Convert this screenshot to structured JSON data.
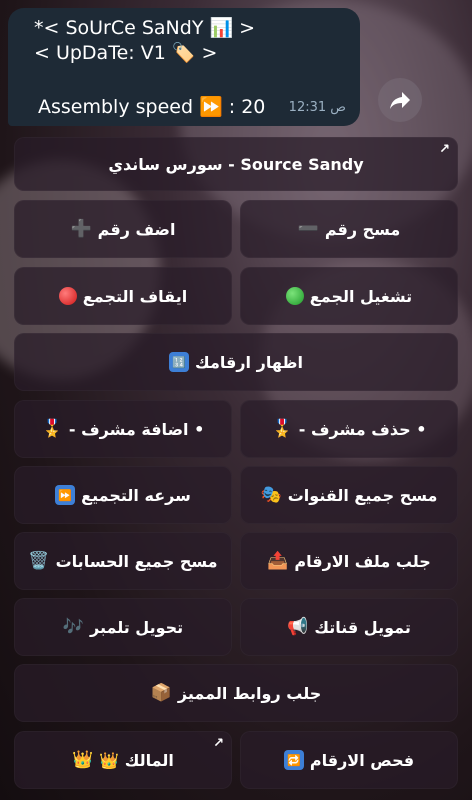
{
  "message": {
    "line1": "*< SoUrCe SaNdY 📊 >",
    "line2": "< UpDaTe: V1 🏷️ >",
    "speed": "Assembly speed ⏩ : 20",
    "time": "12:31 ص"
  },
  "keyboard": {
    "row1": {
      "label": "سورس ساندي - Source Sandy"
    },
    "row2": [
      {
        "label": "مسح رقم",
        "icon": "➖"
      },
      {
        "label": "اضف رقم",
        "icon": "➕"
      }
    ],
    "row3": [
      {
        "label": "تشغيل الجمع",
        "icon": "green-circle"
      },
      {
        "label": "ايقاف التجمع",
        "icon": "red-circle"
      }
    ],
    "row4": {
      "label": "اظهار ارقامك",
      "icon": "🔢"
    },
    "row5": [
      {
        "label": "- حذف مشرف •",
        "icon": "🎖️"
      },
      {
        "label": "- اضافة مشرف •",
        "icon": "🎖️"
      }
    ],
    "row6": [
      {
        "label": "مسح جميع القنوات",
        "icon": "🎭"
      },
      {
        "label": "سرعه التجميع",
        "icon": "⏩"
      }
    ],
    "row7": [
      {
        "label": "جلب ملف الارقام",
        "icon": "📤"
      },
      {
        "label": "مسح جميع الحسابات",
        "icon": "🗑️"
      }
    ],
    "row8": [
      {
        "label": "تمويل قناتك",
        "icon": "📢"
      },
      {
        "label": "تحويل تلمبر",
        "icon": "🎶"
      }
    ],
    "row9": {
      "label": "جلب روابط المميز",
      "icon": "📦"
    },
    "row10": [
      {
        "label": "فحص الارقام",
        "icon": "🔁"
      },
      {
        "label": "👑 المالك",
        "icon": "👑"
      }
    ]
  }
}
